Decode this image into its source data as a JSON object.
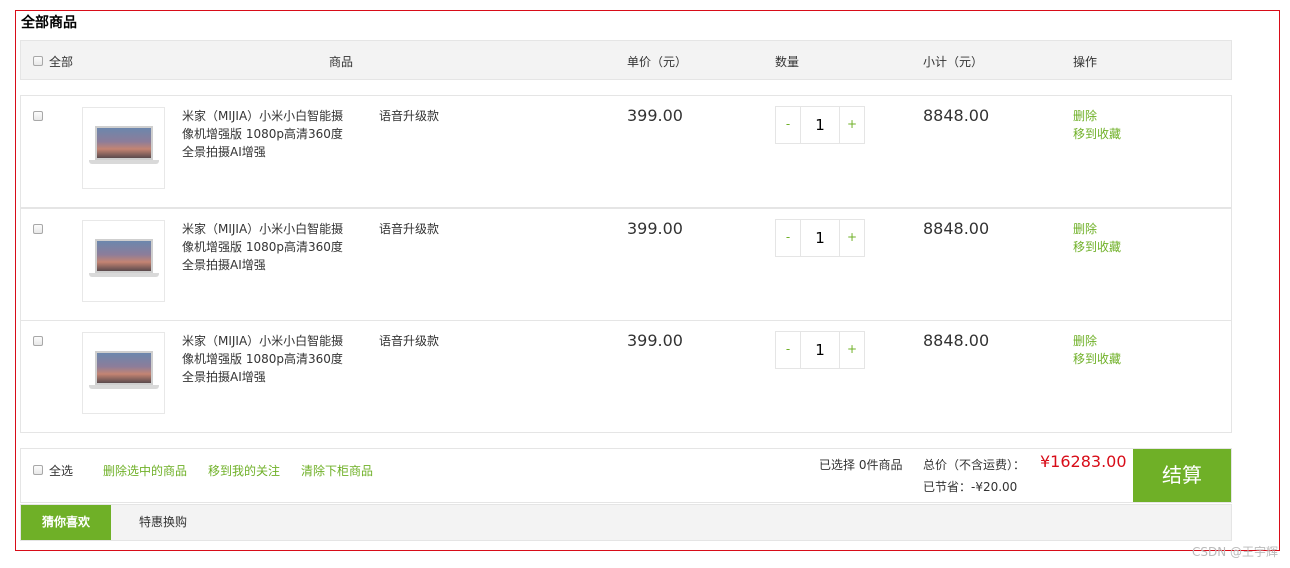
{
  "section_title": "全部商品",
  "header": {
    "select_all": "全部",
    "product": "商品",
    "unit_price": "单价（元）",
    "quantity": "数量",
    "subtotal": "小计（元）",
    "actions": "操作"
  },
  "items": [
    {
      "name": "米家（MIJIA）小米小白智能摄像机增强版 1080p高清360度全景拍摄AI增强",
      "variant": "语音升级款",
      "price": "399.00",
      "minus": "-",
      "qty": "1",
      "plus": "+",
      "subtotal": "8848.00",
      "delete": "删除",
      "move_to_fav": "移到收藏"
    },
    {
      "name": "米家（MIJIA）小米小白智能摄像机增强版 1080p高清360度全景拍摄AI增强",
      "variant": "语音升级款",
      "price": "399.00",
      "minus": "-",
      "qty": "1",
      "plus": "+",
      "subtotal": "8848.00",
      "delete": "删除",
      "move_to_fav": "移到收藏"
    },
    {
      "name": "米家（MIJIA）小米小白智能摄像机增强版 1080p高清360度全景拍摄AI增强",
      "variant": "语音升级款",
      "price": "399.00",
      "minus": "-",
      "qty": "1",
      "plus": "+",
      "subtotal": "8848.00",
      "delete": "删除",
      "move_to_fav": "移到收藏"
    }
  ],
  "footer": {
    "select_all": "全选",
    "delete_selected": "删除选中的商品",
    "move_to_follow": "移到我的关注",
    "clear_off_shelf": "清除下柜商品",
    "selected_count": "已选择 0件商品",
    "total_label": "总价（不含运费）：",
    "total_value": "¥16283.00",
    "saved": "已节省：-¥20.00",
    "checkout": "结算"
  },
  "tabs": {
    "active": "猜你喜欢",
    "other": "特惠换购"
  },
  "watermark": "CSDN @王宇辉",
  "colors": {
    "accent": "#6fb027",
    "price_red": "#d80c18",
    "border": "#e5e5e5",
    "header_bg": "#f3f3f3"
  }
}
